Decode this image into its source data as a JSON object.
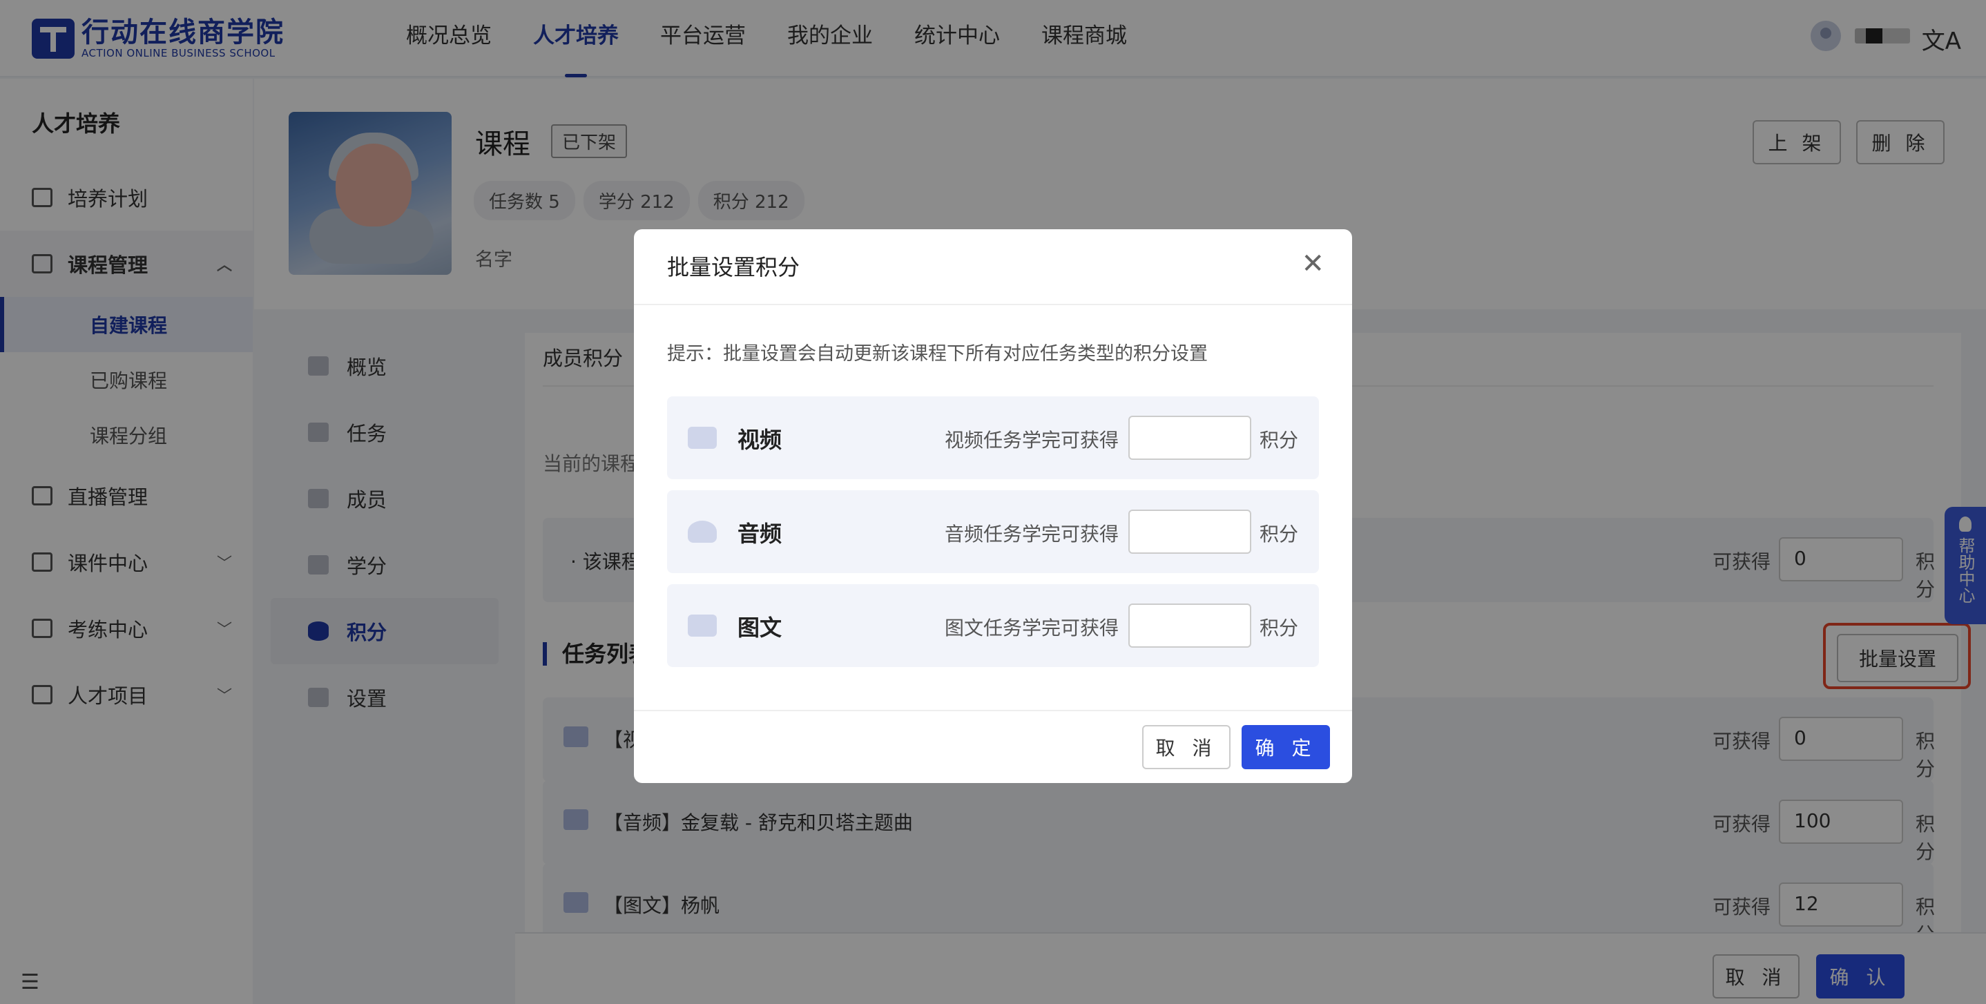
{
  "brand": {
    "name_cn": "行动在线商学院",
    "name_en": "ACTION ONLINE BUSINESS SCHOOL"
  },
  "topnav": {
    "items": [
      {
        "label": "概况总览"
      },
      {
        "label": "人才培养"
      },
      {
        "label": "平台运营"
      },
      {
        "label": "我的企业"
      },
      {
        "label": "统计中心"
      },
      {
        "label": "课程商城"
      }
    ],
    "active_label": "人才培养",
    "lang_icon": "translate-icon"
  },
  "sidebar": {
    "title": "人才培养",
    "items": [
      {
        "label": "培养计划",
        "icon": "calendar-icon"
      },
      {
        "label": "课程管理",
        "icon": "book-icon"
      },
      {
        "label": "自建课程"
      },
      {
        "label": "已购课程"
      },
      {
        "label": "课程分组"
      },
      {
        "label": "直播管理",
        "icon": "video-icon"
      },
      {
        "label": "课件中心",
        "icon": "inbox-icon"
      },
      {
        "label": "考练中心",
        "icon": "exam-icon"
      },
      {
        "label": "人才项目",
        "icon": "project-icon"
      }
    ]
  },
  "course": {
    "title": "课程",
    "status": "已下架",
    "tags": [
      "任务数 5",
      "学分 212",
      "积分 212"
    ],
    "author": "名字",
    "publish_label": "上 架",
    "delete_label": "删 除"
  },
  "subnav": {
    "items": [
      {
        "label": "概览"
      },
      {
        "label": "任务"
      },
      {
        "label": "成员"
      },
      {
        "label": "学分"
      },
      {
        "label": "积分"
      },
      {
        "label": "设置"
      }
    ]
  },
  "main": {
    "tab_label": "成员积分",
    "desc_partial": "当前的课程",
    "complete_row": {
      "label": "· 该课程",
      "get_label": "可获得",
      "value": "0",
      "unit": "积分"
    },
    "section_title": "任务列表",
    "batch_label": "批量设置",
    "tasks": [
      {
        "label": "【视",
        "get_label": "可获得",
        "value": "0",
        "unit": "积分"
      },
      {
        "label": "【音频】金复载 - 舒克和贝塔主题曲",
        "get_label": "可获得",
        "value": "100",
        "unit": "积分"
      },
      {
        "label": "【图文】杨帆",
        "get_label": "可获得",
        "value": "12",
        "unit": "积分"
      }
    ]
  },
  "bottom_bar": {
    "cancel_label": "取 消",
    "confirm_label": "确 认"
  },
  "help": {
    "label": "帮助中心"
  },
  "modal": {
    "title": "批量设置积分",
    "tip": "提示：批量设置会自动更新该课程下所有对应任务类型的积分设置",
    "rows": [
      {
        "name": "视频",
        "hint": "视频任务学完可获得",
        "value": "",
        "unit": "积分",
        "icon": "video-icon"
      },
      {
        "name": "音频",
        "hint": "音频任务学完可获得",
        "value": "",
        "unit": "积分",
        "icon": "headphones-icon"
      },
      {
        "name": "图文",
        "hint": "图文任务学完可获得",
        "value": "",
        "unit": "积分",
        "icon": "image-icon"
      }
    ],
    "cancel_label": "取 消",
    "confirm_label": "确 定"
  },
  "colors": {
    "primary": "#1f3aa6",
    "accent_button": "#2b4ee0",
    "highlight": "#e8452a",
    "overlay": "rgba(0,0,0,0.45)"
  }
}
